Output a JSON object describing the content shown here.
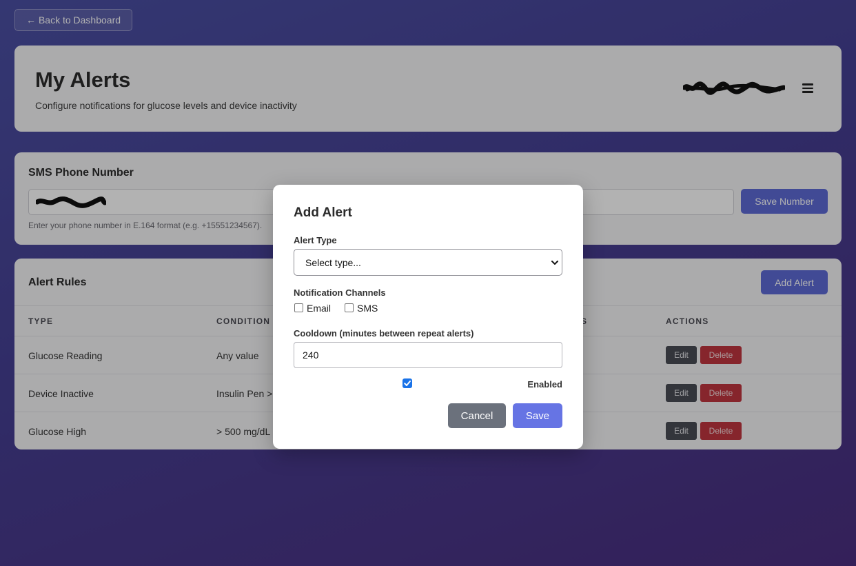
{
  "back_button": {
    "arrow": "←",
    "label": "Back to Dashboard"
  },
  "header": {
    "title": "My Alerts",
    "subtitle": "Configure notifications for glucose levels and device inactivity",
    "menu_icon": "hamburger-menu-icon"
  },
  "sms": {
    "title": "SMS Phone Number",
    "save_label": "Save Number",
    "hint": "Enter your phone number in E.164 format (e.g. +15551234567)."
  },
  "rules": {
    "title": "Alert Rules",
    "add_label": "Add Alert",
    "columns": {
      "type": "TYPE",
      "condition": "CONDITION",
      "channels": "S",
      "actions": "ACTIONS"
    },
    "rows": [
      {
        "type": "Glucose Reading",
        "condition": "Any value",
        "edit": "Edit",
        "delete": "Delete"
      },
      {
        "type": "Device Inactive",
        "condition": "Insulin Pen >",
        "edit": "Edit",
        "delete": "Delete"
      },
      {
        "type": "Glucose High",
        "condition": "> 500 mg/dL",
        "edit": "Edit",
        "delete": "Delete"
      }
    ]
  },
  "modal": {
    "title": "Add Alert",
    "alert_type_label": "Alert Type",
    "alert_type_value": "Select type...",
    "channels_label": "Notification Channels",
    "channel_email": "Email",
    "channel_sms": "SMS",
    "email_checked": false,
    "sms_checked": false,
    "cooldown_label": "Cooldown (minutes between repeat alerts)",
    "cooldown_value": "240",
    "enabled_label": "Enabled",
    "enabled_checked": true,
    "cancel_label": "Cancel",
    "save_label": "Save"
  },
  "colors": {
    "primary": "#5d6bd6",
    "danger": "#c0353f",
    "secondary": "#6b717c",
    "checkbox_accent": "#1a73e8"
  }
}
